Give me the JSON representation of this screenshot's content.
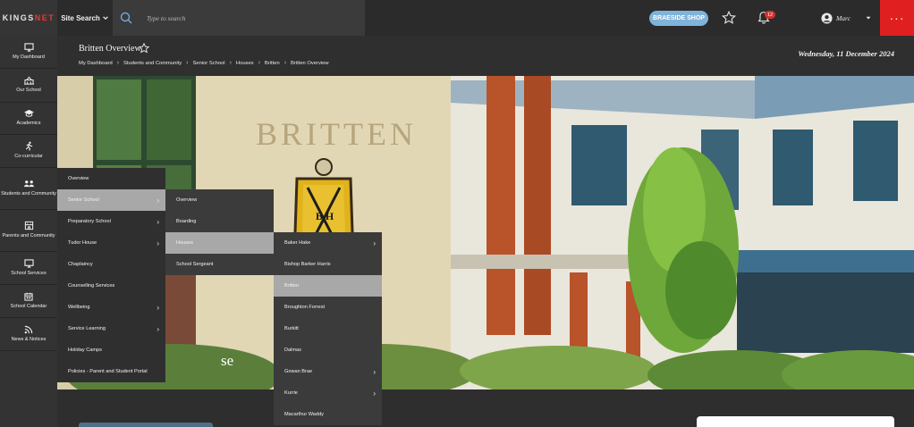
{
  "topbar": {
    "logo_prefix": "KINGS",
    "logo_suffix": "NET",
    "site_search_label": "Site Search",
    "search_placeholder": "Type to search",
    "shop_button": "BRAESIDE SHOP",
    "notification_count": "12",
    "user_name": "Marc",
    "more_label": "···"
  },
  "page": {
    "title": "Britten Overview",
    "date": "Wednesday, 11 December 2024",
    "breadcrumbs": [
      "My Dashboard",
      "Students and Community",
      "Senior School",
      "Houses",
      "Britten",
      "Britten Overview"
    ]
  },
  "sidebar": {
    "items": [
      {
        "label": "My Dashboard",
        "icon": "monitor-icon"
      },
      {
        "label": "Our School",
        "icon": "school-icon"
      },
      {
        "label": "Academics",
        "icon": "graduation-cap-icon"
      },
      {
        "label": "Co-curricular",
        "icon": "running-icon"
      },
      {
        "label": "Students and Community",
        "icon": "users-icon"
      },
      {
        "label": "Parents and Community",
        "icon": "building-icon"
      },
      {
        "label": "School Services",
        "icon": "monitor-icon"
      },
      {
        "label": "School Calendar",
        "icon": "calendar-icon"
      },
      {
        "label": "News & Notices",
        "icon": "rss-icon"
      }
    ]
  },
  "hero": {
    "sign_text": "BRITTEN",
    "crest_letters": "B H",
    "caption": "se"
  },
  "menu_level1": [
    {
      "label": "Overview",
      "has_children": false,
      "active": false
    },
    {
      "label": "Senior School",
      "has_children": true,
      "active": true
    },
    {
      "label": "Preparatory School",
      "has_children": true,
      "active": false
    },
    {
      "label": "Tudor House",
      "has_children": true,
      "active": false
    },
    {
      "label": "Chaplaincy",
      "has_children": false,
      "active": false
    },
    {
      "label": "Counselling Services",
      "has_children": false,
      "active": false
    },
    {
      "label": "Wellbeing",
      "has_children": true,
      "active": false
    },
    {
      "label": "Service Learning",
      "has_children": true,
      "active": false
    },
    {
      "label": "Holiday Camps",
      "has_children": false,
      "active": false
    },
    {
      "label": "Policies - Parent and Student Portal",
      "has_children": false,
      "active": false
    }
  ],
  "menu_level2": [
    {
      "label": "Overview",
      "has_children": false,
      "active": false
    },
    {
      "label": "Boarding",
      "has_children": false,
      "active": false
    },
    {
      "label": "Houses",
      "has_children": false,
      "active": true
    },
    {
      "label": "School Sergeant",
      "has_children": false,
      "active": false
    }
  ],
  "menu_level3": [
    {
      "label": "Baker Hake",
      "has_children": true,
      "active": false
    },
    {
      "label": "Bishop Barker Harris",
      "has_children": false,
      "active": false
    },
    {
      "label": "Britten",
      "has_children": false,
      "active": true
    },
    {
      "label": "Broughton Forrest",
      "has_children": false,
      "active": false
    },
    {
      "label": "Burkitt",
      "has_children": false,
      "active": false
    },
    {
      "label": "Dalmas",
      "has_children": false,
      "active": false
    },
    {
      "label": "Gowan Brae",
      "has_children": true,
      "active": false
    },
    {
      "label": "Kurrie",
      "has_children": true,
      "active": false
    },
    {
      "label": "Macarthur Waddy",
      "has_children": false,
      "active": false
    }
  ],
  "colors": {
    "accent_red": "#e02020",
    "shop_blue": "#7fb3d9",
    "menu_active": "#a8a8a8"
  }
}
